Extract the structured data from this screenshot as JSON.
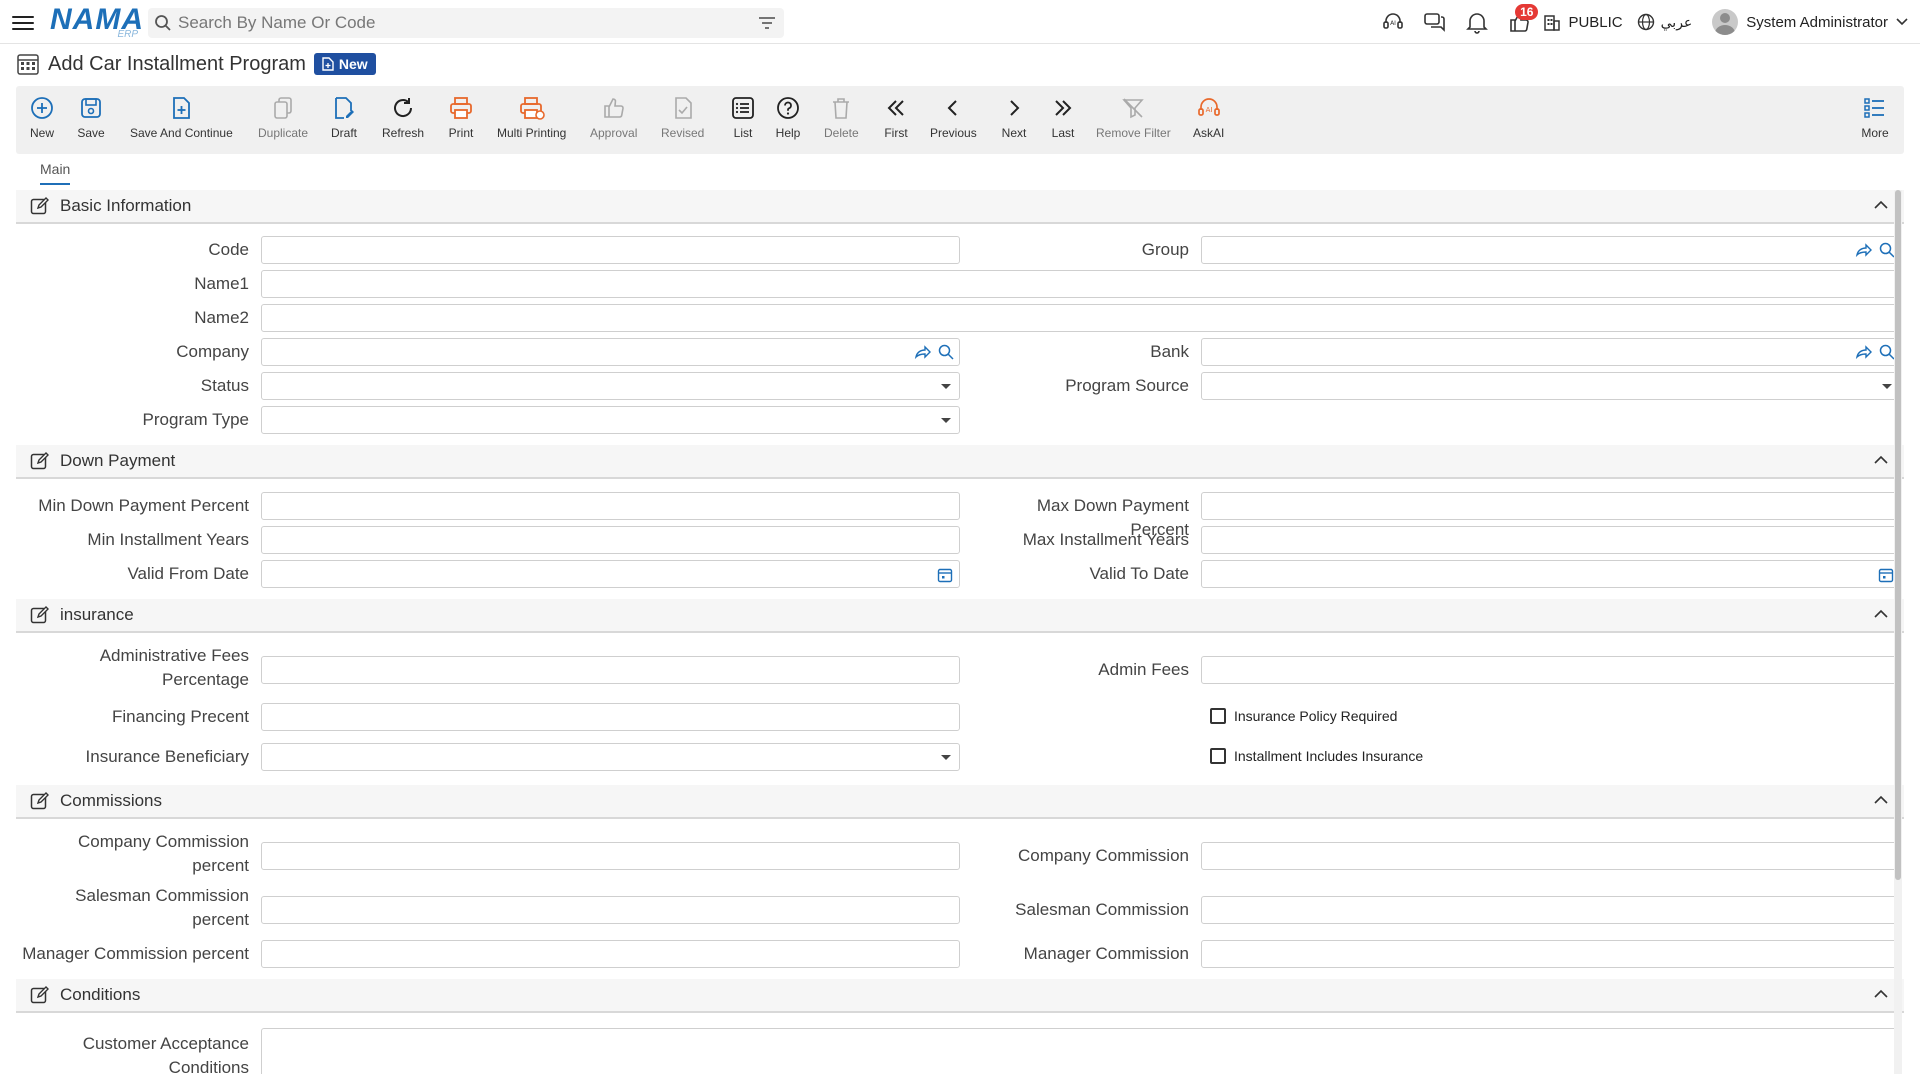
{
  "header": {
    "logo_main": "NAMA",
    "logo_sub": "ERP",
    "search_placeholder": "Search By Name Or Code",
    "notifications_count": "16",
    "public_label": "PUBLIC",
    "language_label": "عربي",
    "user_name": "System Administrator"
  },
  "page": {
    "title": "Add Car Installment Program",
    "status_badge": "New"
  },
  "toolbar": {
    "new": "New",
    "save": "Save",
    "save_continue": "Save And Continue",
    "duplicate": "Duplicate",
    "draft": "Draft",
    "refresh": "Refresh",
    "print": "Print",
    "multi_printing": "Multi Printing",
    "approval": "Approval",
    "revised": "Revised",
    "list": "List",
    "help": "Help",
    "delete": "Delete",
    "first": "First",
    "previous": "Previous",
    "next": "Next",
    "last": "Last",
    "remove_filter": "Remove Filter",
    "askai": "AskAI",
    "more": "More"
  },
  "tabs": {
    "main": "Main"
  },
  "sections": {
    "basic": {
      "title": "Basic Information",
      "code": "Code",
      "group": "Group",
      "name1": "Name1",
      "name2": "Name2",
      "company": "Company",
      "bank": "Bank",
      "status": "Status",
      "program_source": "Program Source",
      "program_type": "Program Type"
    },
    "down_payment": {
      "title": "Down Payment",
      "min_dp": "Min Down Payment Percent",
      "max_dp": "Max Down Payment Percent",
      "min_years": "Min Installment Years",
      "max_years": "Max Installment Years",
      "valid_from": "Valid From Date",
      "valid_to": "Valid To Date"
    },
    "insurance": {
      "title": "insurance",
      "admin_fees_pct_1": "Administrative Fees",
      "admin_fees_pct_2": "Percentage",
      "admin_fees": "Admin Fees",
      "financing_percent": "Financing Precent",
      "policy_required": "Insurance Policy Required",
      "beneficiary": "Insurance Beneficiary",
      "includes_insurance": "Installment Includes Insurance"
    },
    "commissions": {
      "title": "Commissions",
      "company_pct_1": "Company Commission",
      "company_pct_2": "percent",
      "company": "Company Commission",
      "salesman_pct_1": "Salesman Commission",
      "salesman_pct_2": "percent",
      "salesman": "Salesman Commission",
      "manager_pct": "Manager Commission percent",
      "manager": "Manager Commission"
    },
    "conditions": {
      "title": "Conditions",
      "customer_1": "Customer Acceptance",
      "customer_2": "Conditions"
    }
  },
  "colors": {
    "brand": "#1d6fb8",
    "badge_bg": "#1f4fa0",
    "print_icon": "#e8692c",
    "notification": "#e53935"
  }
}
